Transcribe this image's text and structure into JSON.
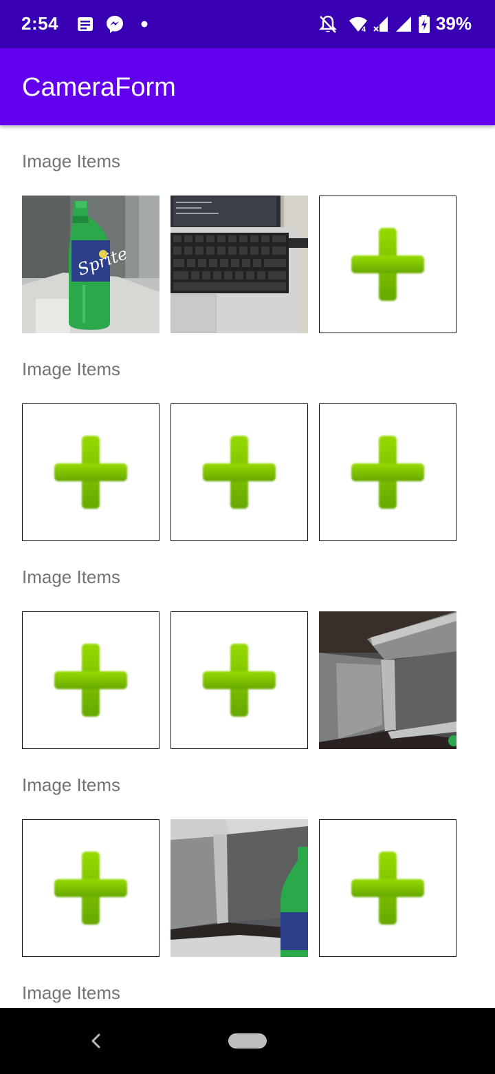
{
  "status_bar": {
    "time": "2:54",
    "battery_percent": "39%",
    "icons": [
      "notes-icon",
      "messenger-icon",
      "dot-icon",
      "bell-off-icon",
      "wifi-icon",
      "signal-icon",
      "battery-icon"
    ]
  },
  "app_bar": {
    "title": "CameraForm"
  },
  "sections": [
    {
      "label": "Image Items",
      "slots": [
        "photo-bottle",
        "photo-laptop",
        "add"
      ]
    },
    {
      "label": "Image Items",
      "slots": [
        "add",
        "add",
        "add"
      ]
    },
    {
      "label": "Image Items",
      "slots": [
        "add",
        "add",
        "photo-cubicle"
      ]
    },
    {
      "label": "Image Items",
      "slots": [
        "add",
        "photo-cubicle-bottle",
        "add"
      ]
    },
    {
      "label": "Image Items",
      "slots": []
    }
  ],
  "colors": {
    "status_bar": "#3700B3",
    "app_bar": "#6200EE",
    "plus_green": "#7CC400"
  },
  "nav_bar": {
    "buttons": [
      "back-icon",
      "home-pill"
    ]
  }
}
